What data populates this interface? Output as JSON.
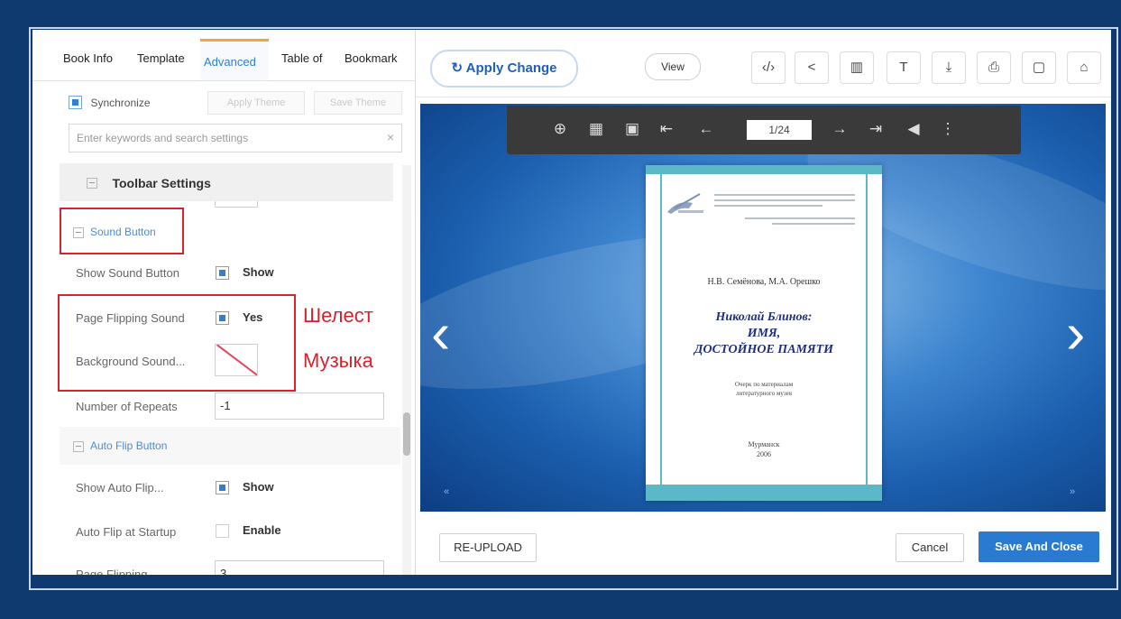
{
  "tabs": [
    "Book Info",
    "Template",
    "Advanced",
    "Table of",
    "Bookmark"
  ],
  "active_tab": "Advanced",
  "settings": {
    "synchronize_label": "Synchronize",
    "apply_theme": "Apply Theme",
    "save_theme": "Save Theme",
    "search_placeholder": "Enter keywords and search settings",
    "search_clear": "×",
    "toolbar_settings": "Toolbar Settings",
    "sound_button_group": "Sound Button",
    "show_sound_button_label": "Show Sound Button",
    "show_value": "Show",
    "page_flipping_sound_label": "Page Flipping Sound",
    "yes_value": "Yes",
    "background_sound_label": "Background Sound...",
    "number_of_repeats_label": "Number of Repeats",
    "number_of_repeats_value": "-1",
    "auto_flip_group": "Auto Flip Button",
    "show_auto_flip_label": "Show Auto Flip...",
    "auto_flip_show_value": "Show",
    "auto_flip_startup_label": "Auto Flip at Startup",
    "enable_value": "Enable",
    "page_flipping_label": "Page Flipping ...",
    "page_flipping_value": "3"
  },
  "annotations": {
    "rustle": "Шелест",
    "music": "Музыка"
  },
  "toolbar": {
    "apply_change": "Apply Change",
    "apply_icon": "↻",
    "view": "View",
    "icons": [
      "code-icon",
      "share-icon",
      "columns-icon",
      "text-icon",
      "download-icon",
      "print-icon",
      "copy-icon",
      "lock-icon"
    ],
    "icon_glyphs": [
      "‹/›",
      "<",
      "▥",
      "T",
      "⤓",
      "⎙",
      "▢",
      "⌂"
    ]
  },
  "viewer": {
    "page_indicator": "1/24",
    "icon_glyphs": [
      "⊕",
      "▦",
      "▣",
      "⇤",
      "←",
      "→",
      "⇥",
      "◀",
      "⋮"
    ],
    "prev_arrow": "‹",
    "next_arrow": "›",
    "corner_left": "«",
    "corner_right": "»"
  },
  "book": {
    "authors": "Н.В. Семёнова, М.А. Орешко",
    "title_line1": "Николай Блинов:",
    "title_line2": "ИМЯ,",
    "title_line3": "ДОСТОЙНОЕ ПАМЯТИ",
    "subtitle_line1": "Очерк по материалам",
    "subtitle_line2": "литературного музея",
    "city": "Мурманск",
    "year": "2006"
  },
  "bottom": {
    "reupload": "RE-UPLOAD",
    "cancel": "Cancel",
    "save_and_close": "Save And Close"
  }
}
